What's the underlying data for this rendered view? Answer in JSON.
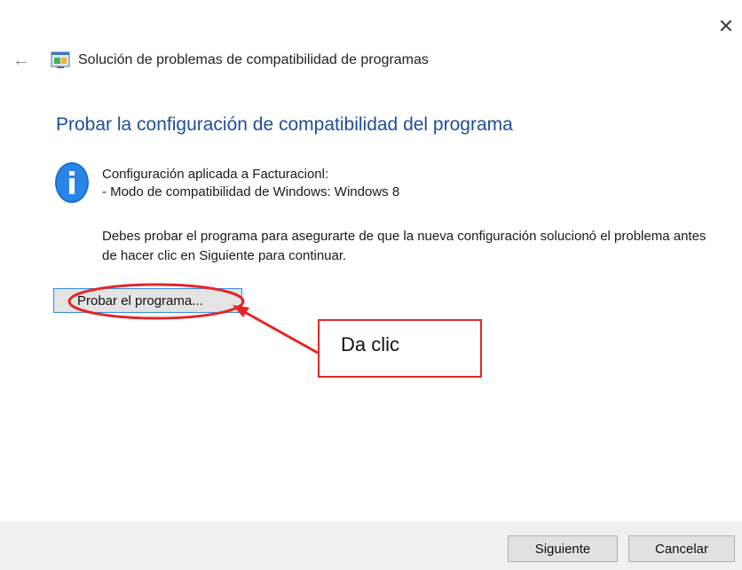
{
  "window": {
    "close_glyph": "✕",
    "title": "Solución de problemas de compatibilidad de programas",
    "back_glyph": "←"
  },
  "main": {
    "page_title": "Probar la configuración de compatibilidad del programa",
    "info_line1": "Configuración aplicada a Facturacionl:",
    "info_line2": "- Modo de compatibilidad de Windows: Windows 8",
    "description": "Debes probar el programa para asegurarte de que la nueva configuración solucionó el problema antes de hacer clic en Siguiente para continuar.",
    "test_button_label": "Probar el programa..."
  },
  "annotation": {
    "callout_text": "Da clic",
    "color": "#e32626"
  },
  "footer": {
    "next_label": "Siguiente",
    "cancel_label": "Cancelar"
  },
  "icons": {
    "close": "close-icon",
    "back": "back-arrow-icon",
    "app": "compatibility-troubleshooter-icon",
    "info": "info-icon"
  }
}
